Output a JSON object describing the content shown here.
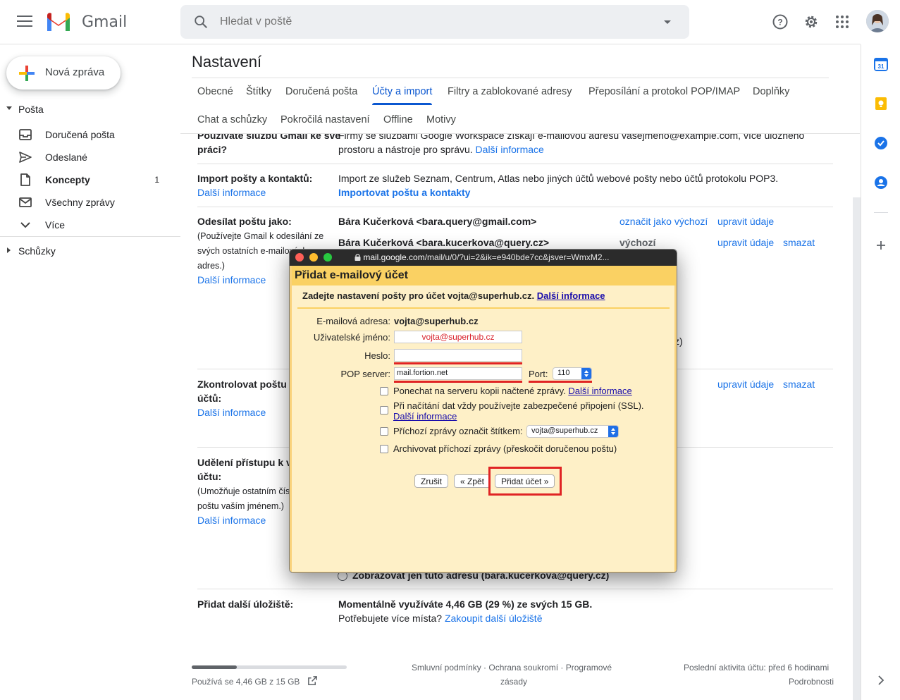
{
  "app": {
    "name": "Gmail"
  },
  "search": {
    "placeholder": "Hledat v poště"
  },
  "compose": {
    "label": "Nová zpráva"
  },
  "sidebar": {
    "section_mail": "Pošta",
    "items": [
      {
        "label": "Doručená pošta",
        "count": ""
      },
      {
        "label": "Odeslané",
        "count": ""
      },
      {
        "label": "Koncepty",
        "count": "1"
      },
      {
        "label": "Všechny zprávy",
        "count": ""
      },
      {
        "label": "Více",
        "count": ""
      }
    ],
    "section_meet": "Schůzky"
  },
  "settings": {
    "title": "Nastavení",
    "tabs": [
      "Obecné",
      "Štítky",
      "Doručená pošta",
      "Účty a import",
      "Filtry a zablokované adresy",
      "Přeposílání a protokol POP/IMAP",
      "Doplňky",
      "Chat a schůzky",
      "Pokročilá nastavení",
      "Offline",
      "Motivy"
    ],
    "active_tab": "Účty a import"
  },
  "rows": {
    "workspace": {
      "label_1": "Používáte službu Gmail ke své",
      "label_2": "práci?",
      "text_1": "Firmy se službami Google Workspace získají e-mailovou adresu vasejmeno@example.com, více úložného",
      "text_2": "prostoru a nástroje pro správu.",
      "link": "Další informace"
    },
    "import": {
      "label": "Import pošty a kontaktů:",
      "link": "Další informace",
      "text": "Import ze služeb Seznam, Centrum, Atlas nebo jiných účtů webové pošty nebo účtů protokolu POP3.",
      "action": "Importovat poštu a kontakty"
    },
    "send_as": {
      "label": "Odesílat poštu jako:",
      "sub_1": "(Používejte Gmail k odesílání ze",
      "sub_2": "svých ostatních e-mailových",
      "sub_3": "adres.)",
      "link": "Další informace",
      "addr_1": "Bára Kučerková <bara.query@gmail.com>",
      "addr_1_make_default": "označit jako výchozí",
      "addr_1_edit": "upravit údaje",
      "addr_2": "Bára Kučerková <bara.kucerkova@query.cz>",
      "addr_2_default": "výchozí",
      "addr_2_edit": "upravit údaje",
      "addr_2_delete": "smazat",
      "tail": "z)"
    },
    "check_mail": {
      "label_1": "Zkontrolovat poštu z",
      "label_2": "účtů:",
      "link": "Další informace",
      "edit": "upravit údaje",
      "delete": "smazat"
    },
    "grant": {
      "label_1": "Udělení přístupu k v",
      "label_2": "účtu:",
      "sub_1": "(Umožňuje ostatním čís",
      "sub_2": "poštu vaším jménem.)",
      "link": "Další informace",
      "radio_text": "Zobrazovat jen tuto adresu (bara.kucerkova@query.cz)"
    },
    "storage": {
      "label": "Přidat další úložiště:",
      "text_1": "Momentálně využíváte 4,46 GB (29 %) ze svých 15 GB.",
      "text_2": "Potřebujete více místa?",
      "link": "Zakoupit další úložiště"
    }
  },
  "footer": {
    "usage": "Používá se 4,46 GB z 15 GB",
    "usage_fraction": 0.29,
    "terms": "Smluvní podmínky · Ochrana soukromí · Programové",
    "terms_2": "zásady",
    "activity": "Poslední aktivita účtu: před 6 hodinami",
    "details": "Podrobnosti"
  },
  "popup": {
    "url_host": "mail.google.com",
    "url_rest": "/mail/u/0/?ui=2&ik=e940bde7cc&jsver=WmxM2...",
    "title": "Přidat e-mailový účet",
    "info": "Zadejte nastavení pošty pro účet vojta@superhub.cz.",
    "info_link": "Další informace",
    "email_label": "E-mailová adresa:",
    "email_value": "vojta@superhub.cz",
    "user_label": "Uživatelské jméno:",
    "user_value": "vojta@superhub.cz",
    "pass_label": "Heslo:",
    "pass_value": "",
    "pop_label": "POP server:",
    "pop_value": "mail.fortion.net",
    "port_label": "Port:",
    "port_value": "110",
    "opt_1": "Ponechat na serveru kopii načtené zprávy.",
    "opt_1_link": "Další informace",
    "opt_2": "Při načítání dat vždy používejte zabezpečené připojení (SSL).",
    "opt_2_link": "Další informace",
    "opt_3": "Příchozí zprávy označit štítkem:",
    "opt_3_select": "vojta@superhub.cz",
    "opt_4": "Archivovat příchozí zprávy (přeskočit doručenou poštu)",
    "btn_cancel": "Zrušit",
    "btn_back": "« Zpět",
    "btn_add": "Přidat účet »"
  }
}
